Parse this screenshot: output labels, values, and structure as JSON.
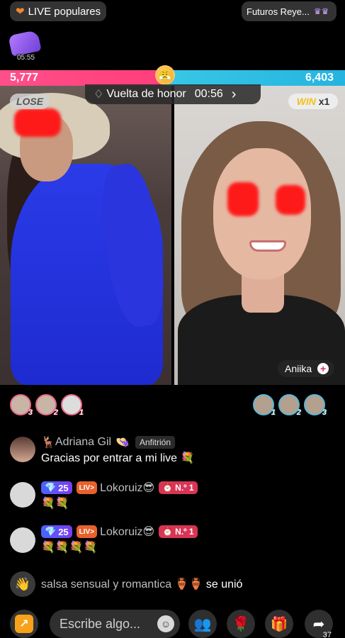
{
  "top_bar": {
    "live_popular_label": "LIVE populares",
    "future_kings_label": "Futuros Reye..."
  },
  "gift_badge": {
    "timer": "05:55"
  },
  "battle": {
    "left_score": "5,777",
    "right_score": "6,403",
    "honor_label": "Vuelta de honor",
    "honor_timer": "00:56",
    "lose_label": "LOSE",
    "win_label": "WIN",
    "win_multiplier": "x1",
    "right_streamer_name": "Aniika"
  },
  "supporters": {
    "left": [
      {
        "rank": "3"
      },
      {
        "rank": "2"
      },
      {
        "rank": "1"
      }
    ],
    "right": [
      {
        "rank": "1"
      },
      {
        "rank": "2"
      },
      {
        "rank": "3"
      }
    ]
  },
  "chat": {
    "messages": [
      {
        "username": "Adriana Gil",
        "host_badge": "Anfitrión",
        "text": "Gracias por entrar a mi live 💐"
      },
      {
        "level": "25",
        "lv_badge": "LIV>",
        "username": "Lokoruiz😎",
        "no_badge": "N.º 1",
        "text": "💐💐"
      },
      {
        "level": "25",
        "lv_badge": "LIV>",
        "username": "Lokoruiz😎",
        "no_badge": "N.º 1",
        "text": "💐💐💐💐"
      }
    ],
    "join": {
      "username": "salsa sensual y romantica",
      "suffix": "se unió"
    }
  },
  "bottom_bar": {
    "input_placeholder": "Escribe algo...",
    "share_count": "37"
  },
  "colors": {
    "left_team": "#ff4f8b",
    "right_team": "#24b4e0",
    "background": "#000000"
  }
}
